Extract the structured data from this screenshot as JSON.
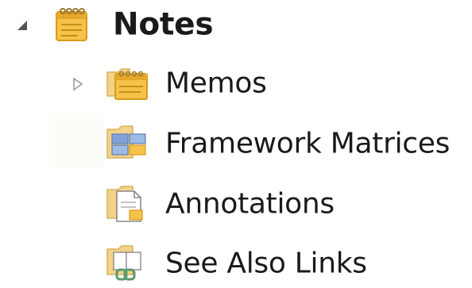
{
  "tree": {
    "root": {
      "label": "Notes",
      "icon": "notepad-folder-icon",
      "expanded": true
    },
    "children": [
      {
        "label": "Memos",
        "icon": "memo-folder-icon",
        "expander": "collapsed"
      },
      {
        "label": "Framework Matrices",
        "icon": "matrix-folder-icon",
        "expander": null
      },
      {
        "label": "Annotations",
        "icon": "annotation-folder-icon",
        "expander": null
      },
      {
        "label": "See Also Links",
        "icon": "link-folder-icon",
        "expander": null
      }
    ]
  },
  "colors": {
    "folder": "#f5c24a",
    "folder_dark": "#e2a62a",
    "expander": "#555555",
    "expander_outline": "#9a9a9a",
    "matrix_blue": "#7fa3d6",
    "link_green": "#5a9a6e"
  }
}
